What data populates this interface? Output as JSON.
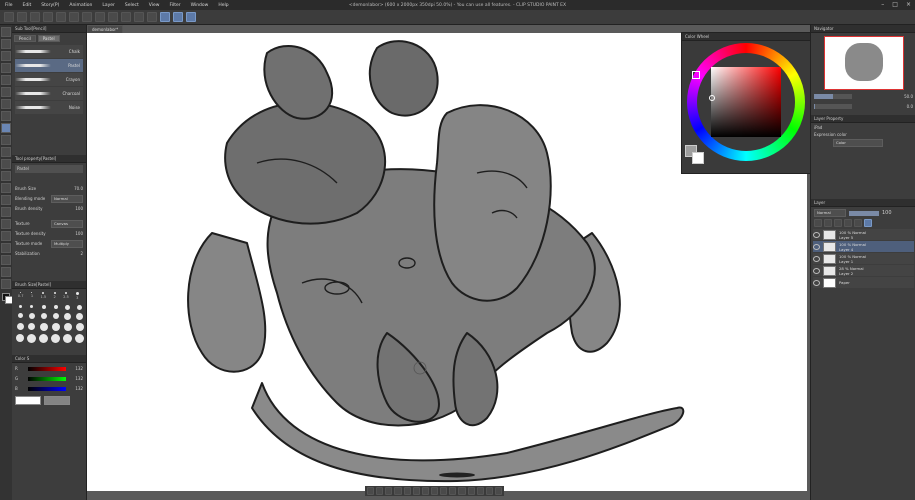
{
  "menubar": {
    "items": [
      "File",
      "Edit",
      "Story(P)",
      "Animation",
      "Layer",
      "Select",
      "View",
      "Filter",
      "Window",
      "Help"
    ],
    "window_title": "<demonlabor> (600 x 2000px 350dpi 50.0%) - You can use all features. - CLIP STUDIO PAINT EX"
  },
  "document_tab": "demonlabor*",
  "left_panel": {
    "subtool_title": "Sub Tool[Pencil]",
    "tabs": [
      "Pencil",
      "Pastel"
    ],
    "brushes": [
      "Chalk",
      "Pastel",
      "Crayon",
      "Charcoal",
      "Noise"
    ],
    "tool_property_title": "Tool property[Pastel]",
    "tool_property_name": "Pastel",
    "props": [
      {
        "label": "Brush Size",
        "value": "70.0"
      },
      {
        "label": "Blending mode",
        "value": "Normal"
      },
      {
        "label": "Brush density",
        "value": "100"
      },
      {
        "label": "Texture",
        "value": "Canvas"
      },
      {
        "label": "Texture density",
        "value": "100"
      },
      {
        "label": "Texture mode",
        "value": "Multiply"
      },
      {
        "label": "Stabilization",
        "value": "2"
      }
    ],
    "brush_size_title": "Brush Size[Pastel]",
    "size_labels": [
      "0.7",
      "1",
      "1.5",
      "2",
      "2.5",
      "3"
    ],
    "color_title": "Color S",
    "rgb": [
      {
        "label": "R",
        "value": "132"
      },
      {
        "label": "G",
        "value": "132"
      },
      {
        "label": "B",
        "value": "132"
      }
    ]
  },
  "color_wheel": {
    "title": "Color Wheel"
  },
  "right_panel": {
    "navigator_title": "Navigator",
    "zoom": "50.0",
    "rotate": "0.0",
    "layer_property_title": "Layer Property",
    "layer_property_name": "iPad",
    "expression_color_label": "Expression color",
    "expression_color_value": "Color",
    "layer_panel_title": "Layer",
    "blend_mode": "Normal",
    "opacity": "100",
    "layers": [
      {
        "percent": "100 % Normal",
        "name": "Layer 5"
      },
      {
        "percent": "100 % Normal",
        "name": "Layer 4"
      },
      {
        "percent": "100 % Normal",
        "name": "Layer 1"
      },
      {
        "percent": "28 % Normal",
        "name": "Layer 2"
      },
      {
        "percent": "",
        "name": "Paper"
      }
    ]
  }
}
